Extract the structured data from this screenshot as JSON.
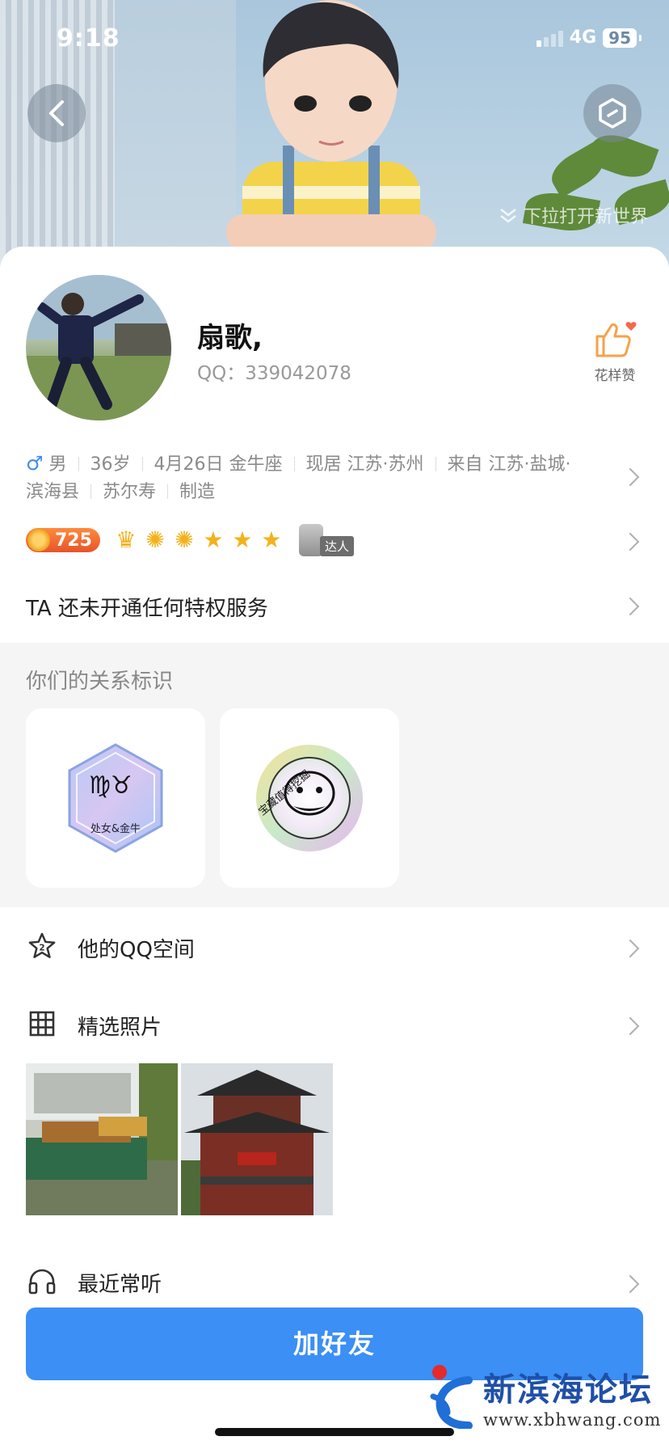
{
  "status_bar": {
    "time": "9:18",
    "network": "4G",
    "battery": "95"
  },
  "cover": {
    "pull_hint": "下拉打开新世界"
  },
  "profile": {
    "name": "扇歌,",
    "qq_label": "QQ：",
    "qq_number": "339042078",
    "like_label": "花样赞",
    "info": {
      "gender_symbol": "♂",
      "gender": "男",
      "age": "36岁",
      "birthday": "4月26日 金牛座",
      "residence": "现居 江苏·苏州",
      "hometown_line1": "来自 江苏·盐城·",
      "hometown_line2": "滨海县",
      "occupation_company": "苏尔寿",
      "industry": "制造"
    },
    "coin_value": "725",
    "expert_tag": "达人",
    "privilege_text": "TA 还未开通任何特权服务"
  },
  "relation": {
    "title": "你们的关系标识",
    "badges": [
      {
        "label": "处女&金牛",
        "zodiac": "♍♉"
      },
      {
        "label": "宝藏值得挖掘"
      }
    ]
  },
  "list": {
    "qzone": "他的QQ空间",
    "photos": "精选照片",
    "music": "最近常听"
  },
  "add_button": "加好友",
  "watermark": {
    "title": "新滨海论坛",
    "url": "www.xbhwang.com"
  },
  "colors": {
    "accent": "#3b8ff5",
    "like": "#f5a24a",
    "coin": "#e8542a"
  }
}
